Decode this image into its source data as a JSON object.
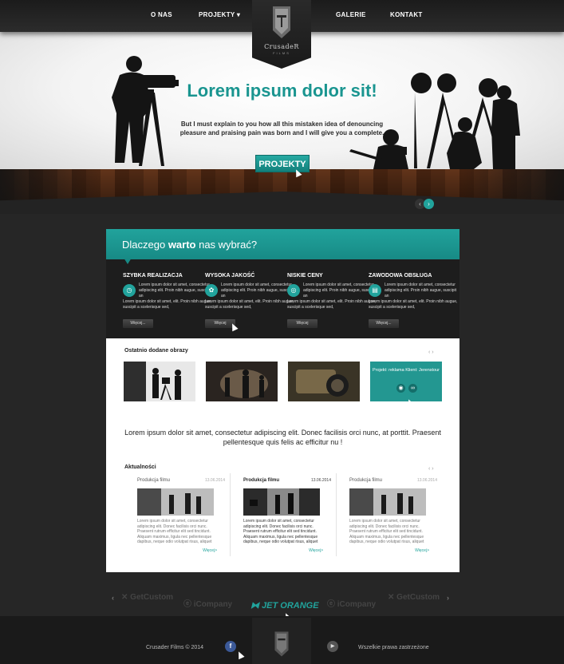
{
  "nav": {
    "left": [
      "O NAS",
      "PROJEKTY"
    ],
    "right": [
      "GALERIE",
      "KONTAKT"
    ],
    "logo_text": "CrusadeR",
    "logo_sub": "FILMS"
  },
  "hero": {
    "title": "Lorem ipsum dolor sit!",
    "text": "But I must explain to you how all this mistaken idea of denouncing pleasure and praising pain was born and I will give you a complete.",
    "button": "PROJEKTY"
  },
  "why": {
    "title_pre": "Dlaczego ",
    "title_bold": "warto",
    "title_post": " nas wybrać?",
    "features": [
      {
        "title": "SZYBKA REALIZACJA",
        "icon": "clock-icon",
        "glyph": "◷",
        "desc": "Lorem ipsum dolor sit amet, consectetur adipiscing elit. Proin nibh augue, suscipit an",
        "desc2": "Lorem ipsum dolor sit amet, elit. Proin nibh augue, suscipit a scelerisque sed,",
        "button": "Więcej..."
      },
      {
        "title": "WYSOKA JAKOŚĆ",
        "icon": "award-icon",
        "glyph": "✿",
        "desc": "Lorem ipsum dolor sit amet, consectetur adipiscing elit. Proin nibh augue, suscipit an",
        "desc2": "Lorem ipsum dolor sit amet, elit. Proin nibh augue, suscipit a scelerisque sed,",
        "button": "Więcej"
      },
      {
        "title": "NISKIE CENY",
        "icon": "coins-icon",
        "glyph": "◎",
        "desc": "Lorem ipsum dolor sit amet, consectetur adipiscing elit. Proin nibh augue, suscipit an",
        "desc2": "Lorem ipsum dolor sit amet, elit. Proin nibh augue, suscipit a scelerisque sed,",
        "button": "Więcej"
      },
      {
        "title": "ZAWODOWA OBSŁUGA",
        "icon": "clapper-icon",
        "glyph": "▤",
        "desc": "Lorem ipsum dolor sit amet, consectetur adipiscing elit. Proin nibh augue, suscipit an",
        "desc2": "Lorem ipsum dolor sit amet, elit. Proin nibh augue, suscipit a scelerisque sed,",
        "button": "Więcej..."
      }
    ]
  },
  "gallery": {
    "title": "Ostatnio dodane obrazy",
    "arrows": "‹ ›",
    "overlay_text": "Projekt: reklama Klient: Jerenstour"
  },
  "quote": "Lorem ipsum dolor sit amet, consectetur adipiscing elit. Donec facilisis orci nunc, at porttit. Praesent pellentesque quis felis ac efficitur nu !",
  "news": {
    "title": "Aktualności",
    "arrows": "‹ ›",
    "items": [
      {
        "cat": "Produkcja filmu",
        "date": "13.06.2014",
        "text": "Lorem ipsum dolor sit amet, consectetur adipiscing elit. Donec facilisis orci nunc. Praesent rutrum efficitur elit sed tincidunt. Aliquam maximus, ligula nec pellentesque dapibus, neque odio volutpat risus, aliquet",
        "more": "Więcej>"
      },
      {
        "cat": "Produkcja filmu",
        "date": "13.06.2014",
        "text": "Lorem ipsum dolor sit amet, consectetur adipiscing elit. Donec facilisis orci nunc. Praesent rutrum efficitur elit sed tincidunt. Aliquam maximus, ligula nec pellentesque dapibus, neque odio volutpat risus, aliquet",
        "more": "Więcej>"
      },
      {
        "cat": "Produkcja filmu",
        "date": "13.06.2014",
        "text": "Lorem ipsum dolor sit amet, consectetur adipiscing elit. Donec facilisis orci nunc. Praesent rutrum efficitur elit sed tincidunt. Aliquam maximus, ligula nec pellentesque dapibus, neque odio volutpat risus, aliquet",
        "more": "Więcej>"
      }
    ]
  },
  "partners": [
    "GetCustom",
    "iCompany",
    "JET ORANGE",
    "iCompany",
    "GetCustom"
  ],
  "footer": {
    "copyright": "Crusader Films © 2014",
    "rights": "Wszelkie prawa zastrzeżone",
    "facebook": "f",
    "youtube": "▶"
  },
  "colors": {
    "accent": "#21a39c",
    "dark": "#1d1d1d",
    "background": "#262626"
  }
}
